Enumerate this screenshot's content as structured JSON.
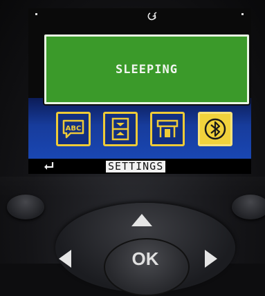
{
  "screen": {
    "status_icon": "hook-icon",
    "popup": {
      "message": "SLEEPING"
    },
    "menu_icons": [
      {
        "name": "abc-speech-icon",
        "selected": false
      },
      {
        "name": "media-loading-icon",
        "selected": false
      },
      {
        "name": "printhead-icon",
        "selected": false
      },
      {
        "name": "bluetooth-icon",
        "selected": true
      }
    ],
    "bottom_bar": {
      "back_icon": "back-return-icon",
      "label": "SETTINGS"
    }
  },
  "keypad": {
    "ok_label": "OK"
  },
  "colors": {
    "popup_green": "#3b9a2a",
    "icon_yellow": "#efcb37",
    "screen_blue": "#173c9c"
  }
}
